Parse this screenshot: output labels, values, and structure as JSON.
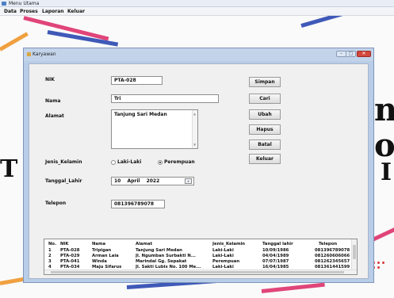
{
  "main_window": {
    "title": "Menu Utama",
    "menu": [
      "Data",
      "Proses",
      "Laporan",
      "Keluar"
    ]
  },
  "form": {
    "title": "Karyawan",
    "labels": {
      "nik": "NIK",
      "nama": "Nama",
      "alamat": "Alamat",
      "jenis_kelamin": "Jenis_Kelamin",
      "tanggal_lahir": "Tanggal_Lahir",
      "telepon": "Telepon"
    },
    "values": {
      "nik": "PTA-028",
      "nama": "Tri",
      "alamat": "Tanjung Sari Medan",
      "tanggal_lahir": {
        "day": "10",
        "month": "April",
        "year": "2022"
      },
      "telepon": "081396789078"
    },
    "gender_options": [
      {
        "label": "Laki-Laki",
        "selected": false
      },
      {
        "label": "Perempuan",
        "selected": true
      }
    ],
    "buttons": [
      "Simpan",
      "Cari",
      "Ubah",
      "Hapus",
      "Batal",
      "Keluar"
    ]
  },
  "grid": {
    "columns": [
      "No.",
      "NIK",
      "Nama",
      "Alamat",
      "Jenis_Kelamin",
      "Tanggal lahir",
      "Telepon"
    ],
    "rows": [
      [
        "1",
        "PTA-028",
        "Tripigan",
        "Tanjung Sari Medan",
        "Laki-Laki",
        "10/09/1986",
        "081396789078"
      ],
      [
        "2",
        "PTA-029",
        "Arman Laia",
        "Jl. Ngumban Surbakti N...",
        "Laki-Laki",
        "04/04/1989",
        "081260606066"
      ],
      [
        "3",
        "PTA-041",
        "Winda",
        "Marindal Gg. Sepakat",
        "Perempuan",
        "07/07/1987",
        "081262345657"
      ],
      [
        "4",
        "PTA-034",
        "Maju Sifarus",
        "Jl. Sakti Lubis No. 100 Me...",
        "Laki-Laki",
        "16/04/1985",
        "081361441599"
      ]
    ]
  },
  "background": {
    "words": [
      "nt",
      "ov",
      "T",
      "I"
    ]
  },
  "colors": {
    "accent_red": "#d4473c",
    "form_frame": "#b8cde8",
    "stripe_blue": "#3f59b8",
    "stripe_orange": "#f0a040",
    "stripe_pink": "#e0457a"
  }
}
